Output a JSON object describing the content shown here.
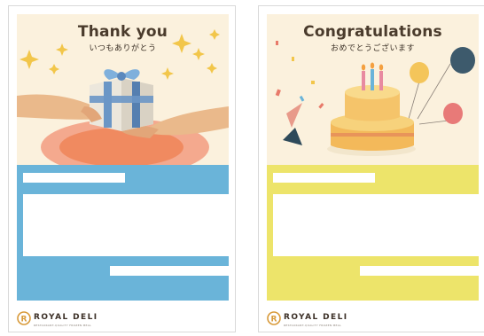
{
  "cards": [
    {
      "title": "Thank you",
      "subtitle": "いつもありがとう",
      "brand": "ROYAL DELI",
      "brand_tagline": "RESTAURANT-QUALITY FROZEN MEAL",
      "panel_color": "#6ab4d9"
    },
    {
      "title": "Congratulations",
      "subtitle": "おめでとうございます",
      "brand": "ROYAL DELI",
      "brand_tagline": "RESTAURANT-QUALITY FROZEN MEAL",
      "panel_color": "#ede46a"
    }
  ],
  "icons": {
    "gift": "gift-box-icon",
    "cake": "birthday-cake-icon",
    "logo": "royal-deli-logo-icon"
  }
}
